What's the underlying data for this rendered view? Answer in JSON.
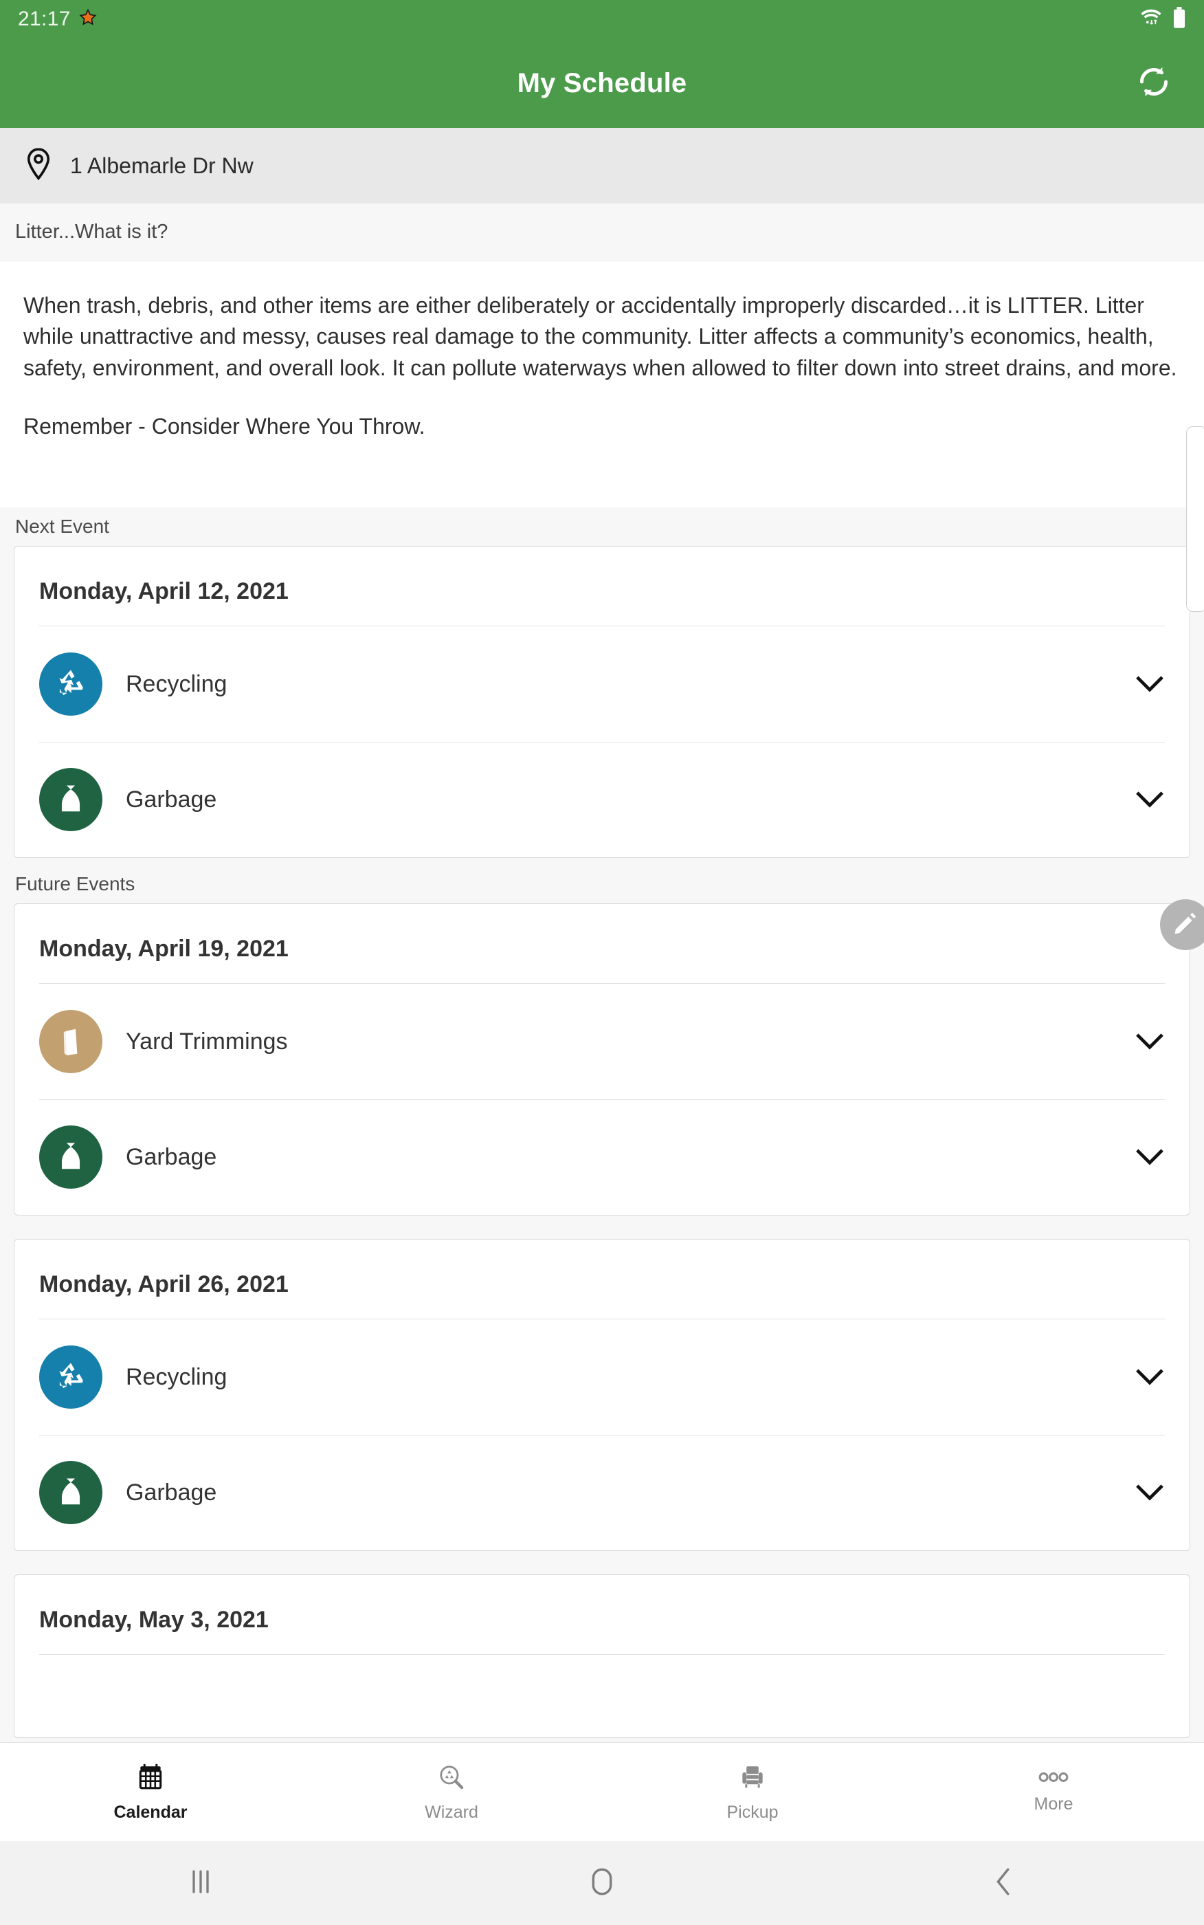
{
  "statusbar": {
    "time": "21:17",
    "star_icon": "star-icon",
    "wifi_icon": "wifi-icon",
    "battery_icon": "battery-icon"
  },
  "appbar": {
    "title": "My Schedule",
    "refresh_icon": "refresh-icon"
  },
  "address": {
    "pin_icon": "location-pin-icon",
    "text": "1 Albemarle Dr Nw"
  },
  "info": {
    "heading": "Litter...What is it?",
    "paragraph": "When trash, debris, and other items are either deliberately or accidentally improperly discarded…it is LITTER. Litter while unattractive and messy, causes real damage to the community.  Litter affects a community’s economics, health, safety, environment, and overall look. It can pollute waterways when allowed to filter down into street drains, and more.",
    "remember": "Remember - Consider Where You Throw."
  },
  "sections": {
    "next_event_label": "Next Event",
    "future_events_label": "Future Events"
  },
  "colors": {
    "brand_green": "#4b9b4b",
    "recycling_blue": "#1580ab",
    "garbage_green": "#1f6342",
    "yard_tan": "#c2a06f",
    "fab_gray": "#b5b5b5"
  },
  "cards": [
    {
      "date": "Monday, April 12, 2021",
      "events": [
        {
          "label": "Recycling",
          "icon": "recycling-icon",
          "color": "#1580ab",
          "chevron": "chevron-down-icon"
        },
        {
          "label": "Garbage",
          "icon": "garbage-bag-icon",
          "color": "#1f6342",
          "chevron": "chevron-down-icon"
        }
      ]
    },
    {
      "date": "Monday, April 19, 2021",
      "events": [
        {
          "label": "Yard Trimmings",
          "icon": "yard-bag-icon",
          "color": "#c2a06f",
          "chevron": "chevron-down-icon"
        },
        {
          "label": "Garbage",
          "icon": "garbage-bag-icon",
          "color": "#1f6342",
          "chevron": "chevron-down-icon"
        }
      ]
    },
    {
      "date": "Monday, April 26, 2021",
      "events": [
        {
          "label": "Recycling",
          "icon": "recycling-icon",
          "color": "#1580ab",
          "chevron": "chevron-down-icon"
        },
        {
          "label": "Garbage",
          "icon": "garbage-bag-icon",
          "color": "#1f6342",
          "chevron": "chevron-down-icon"
        }
      ]
    },
    {
      "date": "Monday, May 3, 2021",
      "events": []
    }
  ],
  "fab": {
    "icon": "edit-pencil-icon"
  },
  "bottomnav": {
    "items": [
      {
        "label": "Calendar",
        "icon": "calendar-icon",
        "active": true
      },
      {
        "label": "Wizard",
        "icon": "recycling-search-icon",
        "active": false
      },
      {
        "label": "Pickup",
        "icon": "armchair-icon",
        "active": false
      },
      {
        "label": "More",
        "icon": "more-dots-icon",
        "active": false
      }
    ]
  },
  "sysnav": {
    "recents_icon": "recents-icon",
    "home_icon": "home-icon",
    "back_icon": "back-icon"
  }
}
